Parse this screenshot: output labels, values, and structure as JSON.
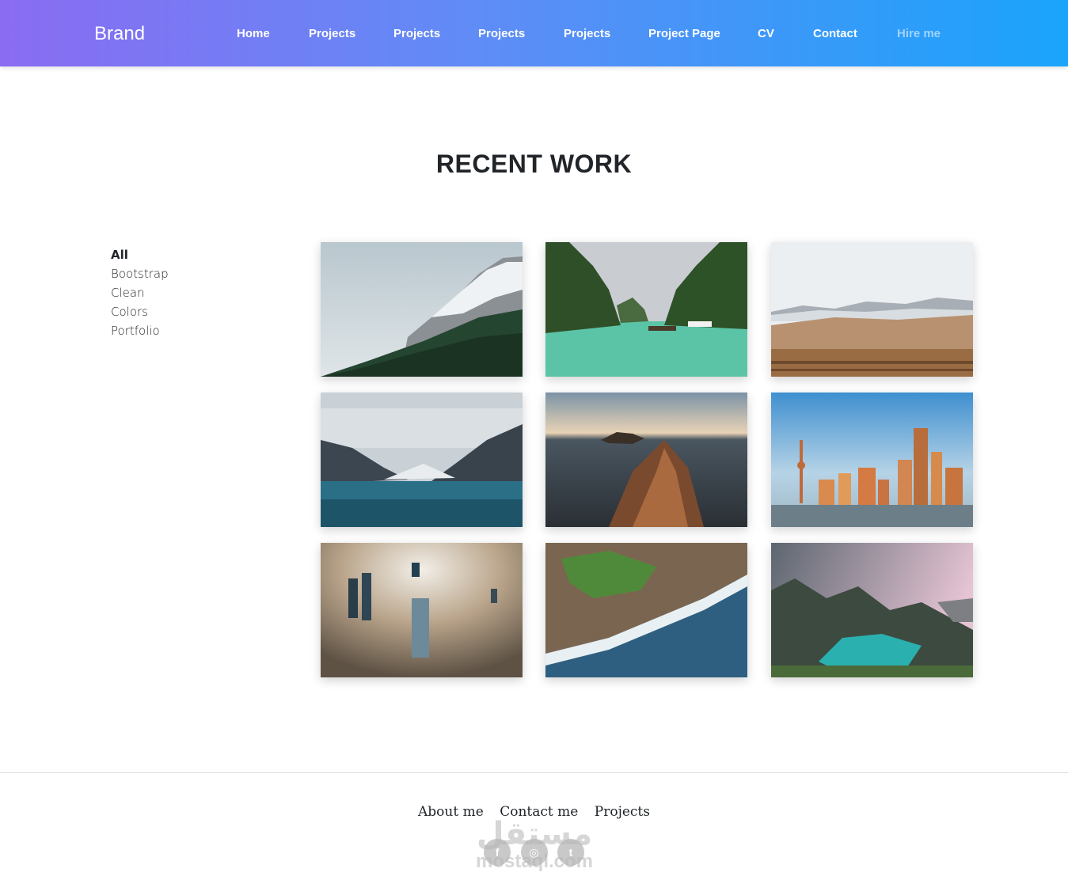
{
  "navbar": {
    "brand": "Brand",
    "links": [
      {
        "label": "Home"
      },
      {
        "label": "Projects"
      },
      {
        "label": "Projects"
      },
      {
        "label": "Projects"
      },
      {
        "label": "Projects"
      },
      {
        "label": "Project Page"
      },
      {
        "label": "CV"
      },
      {
        "label": "Contact"
      },
      {
        "label": "Hire me"
      }
    ]
  },
  "main": {
    "title": "RECENT WORK",
    "filters": [
      "All",
      "Bootstrap",
      "Clean",
      "Colors",
      "Portfolio"
    ],
    "active_filter": "All",
    "gallery": [
      "snowy-mountain-forest",
      "lagoon-cliffs-boats",
      "desert-plain-mountains",
      "mountain-lake",
      "sea-rocks-aerial",
      "city-skyline-river",
      "skyscrapers-above-clouds",
      "coastline-aerial-waves",
      "coastal-mountain-bay"
    ]
  },
  "footer": {
    "links": [
      "About me",
      "Contact me",
      "Projects"
    ],
    "social": [
      {
        "icon": "facebook-icon",
        "glyph": "f"
      },
      {
        "icon": "instagram-icon",
        "glyph": "◎"
      },
      {
        "icon": "twitter-icon",
        "glyph": "t"
      }
    ],
    "watermark_ar": "مستقل",
    "watermark_en": "mostaql.com"
  }
}
